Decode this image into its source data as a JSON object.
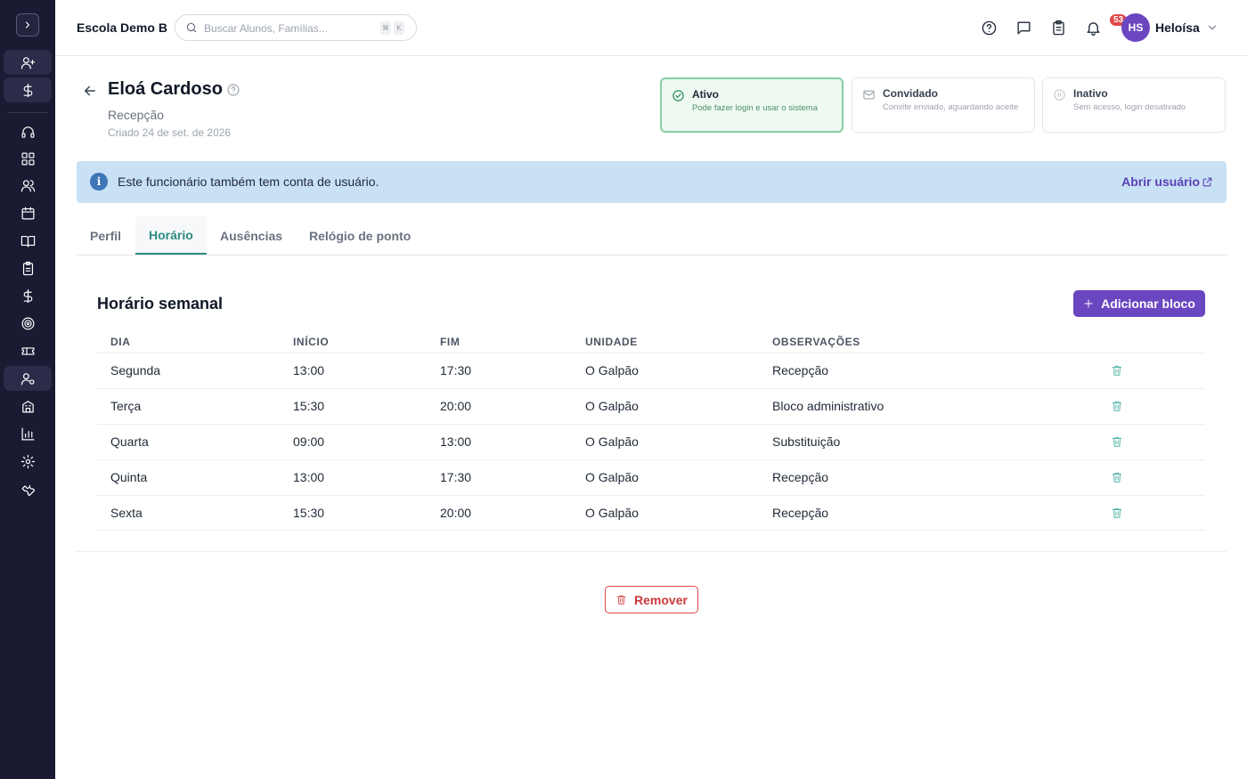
{
  "header": {
    "school_name": "Escola Demo B",
    "search_placeholder": "Buscar Alunos, Famílias...",
    "shortcut_keys": [
      "⌘",
      "K"
    ],
    "notifications_badge": "53",
    "user_initials": "HS",
    "user_name": "Heloísa"
  },
  "employee": {
    "name": "Eloá Cardoso",
    "role": "Recepção",
    "created": "Criado 24 de set. de 2026"
  },
  "status_cards": [
    {
      "title": "Ativo",
      "desc": "Pode fazer login e usar o sistema",
      "selected": true
    },
    {
      "title": "Convidado",
      "desc": "Convite enviado, aguardando aceite",
      "selected": false
    },
    {
      "title": "Inativo",
      "desc": "Sem acesso, login desativado",
      "selected": false
    }
  ],
  "info_banner": {
    "text": "Este funcionário também tem conta de usuário.",
    "link": "Abrir usuário"
  },
  "tabs": [
    {
      "label": "Perfil",
      "active": false
    },
    {
      "label": "Horário",
      "active": true
    },
    {
      "label": "Ausências",
      "active": false
    },
    {
      "label": "Relógio de ponto",
      "active": false
    }
  ],
  "schedule": {
    "title": "Horário semanal",
    "add_button": "Adicionar bloco",
    "columns": [
      "DIA",
      "INÍCIO",
      "FIM",
      "UNIDADE",
      "OBSERVAÇÕES"
    ],
    "rows": [
      [
        "Segunda",
        "13:00",
        "17:30",
        "O Galpão",
        "Recepção"
      ],
      [
        "Terça",
        "15:30",
        "20:00",
        "O Galpão",
        "Bloco administrativo"
      ],
      [
        "Quarta",
        "09:00",
        "13:00",
        "O Galpão",
        "Substituição"
      ],
      [
        "Quinta",
        "13:00",
        "17:30",
        "O Galpão",
        "Recepção"
      ],
      [
        "Sexta",
        "15:30",
        "20:00",
        "O Galpão",
        "Recepção"
      ]
    ]
  },
  "remove_button": "Remover",
  "colors": {
    "sidebar_bg": "#1a1a33",
    "accent_purple": "#6b46c1",
    "tab_active": "#2c8c82",
    "danger": "#d94848",
    "active_status_border": "#86cfa1",
    "info_bg": "#c8e1f5"
  },
  "sidebar_icons": [
    "user-plus-icon",
    "dollar-icon",
    "headset-icon",
    "dashboard-icon",
    "users-icon",
    "calendar-icon",
    "book-icon",
    "clipboard-icon",
    "dollar-icon",
    "target-icon",
    "ticket-icon",
    "staff-icon",
    "building-icon",
    "chart-icon",
    "settings-icon",
    "wrench-icon"
  ]
}
